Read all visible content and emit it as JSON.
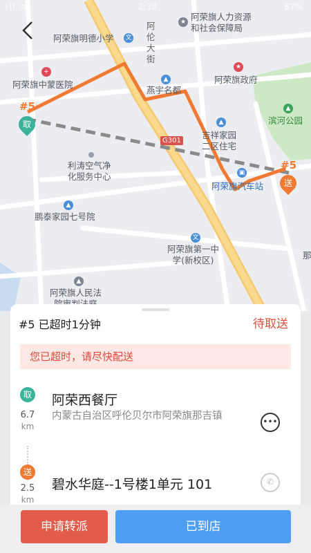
{
  "status_bar": {
    "time": "2:38",
    "battery": "67%"
  },
  "map": {
    "labels": [
      {
        "id": "hr",
        "text": "阿荣旗人力资源\n和社会保障局"
      },
      {
        "id": "school",
        "text": "阿荣旗明德小学"
      },
      {
        "id": "street",
        "text": "阿\n伦\n大\n街"
      },
      {
        "id": "hospital",
        "text": "阿荣旗中蒙医院"
      },
      {
        "id": "gov",
        "text": "阿荣旗政府"
      },
      {
        "id": "yanyu",
        "text": "燕宇名都"
      },
      {
        "id": "binhe",
        "text": "滨河公园"
      },
      {
        "id": "g301",
        "text": "G301"
      },
      {
        "id": "jixiang",
        "text": "吉祥家园\n二区住宅"
      },
      {
        "id": "litao",
        "text": "利涛空气净\n化服务中心"
      },
      {
        "id": "station",
        "text": "阿荣旗汽车站"
      },
      {
        "id": "pengtai",
        "text": "鹏泰家园七号院"
      },
      {
        "id": "middle",
        "text": "阿荣旗第一中\n学(新校区)"
      },
      {
        "id": "court",
        "text": "阿荣旗人民法\n院审判法庭"
      },
      {
        "id": "edge",
        "text": "那"
      }
    ],
    "pickup_pin": "取",
    "pickup_tag": "#5",
    "deliver_pin": "送",
    "deliver_tag": "#5",
    "route_color": "#f07a31"
  },
  "card": {
    "order_status": "#5 已超时1分钟",
    "order_state": "待取送",
    "alert": "您已超时，请尽快配送",
    "pickup": {
      "icon": "取",
      "distance_value": "6.7",
      "distance_unit": "km",
      "name": "阿荣西餐厅",
      "address": "内蒙古自治区呼伦贝尔市阿荣旗那吉镇"
    },
    "delivery": {
      "icon": "送",
      "distance_value": "2.5",
      "distance_unit": "km",
      "name": "碧水华庭--1号楼1单元 101"
    }
  },
  "actions": {
    "reassign": "申请转派",
    "arrived": "已到店"
  },
  "colors": {
    "accent_red": "#e25b4b",
    "accent_blue": "#4e9ef3",
    "pickup_green": "#3bb39a",
    "deliver_orange": "#f07a31"
  }
}
